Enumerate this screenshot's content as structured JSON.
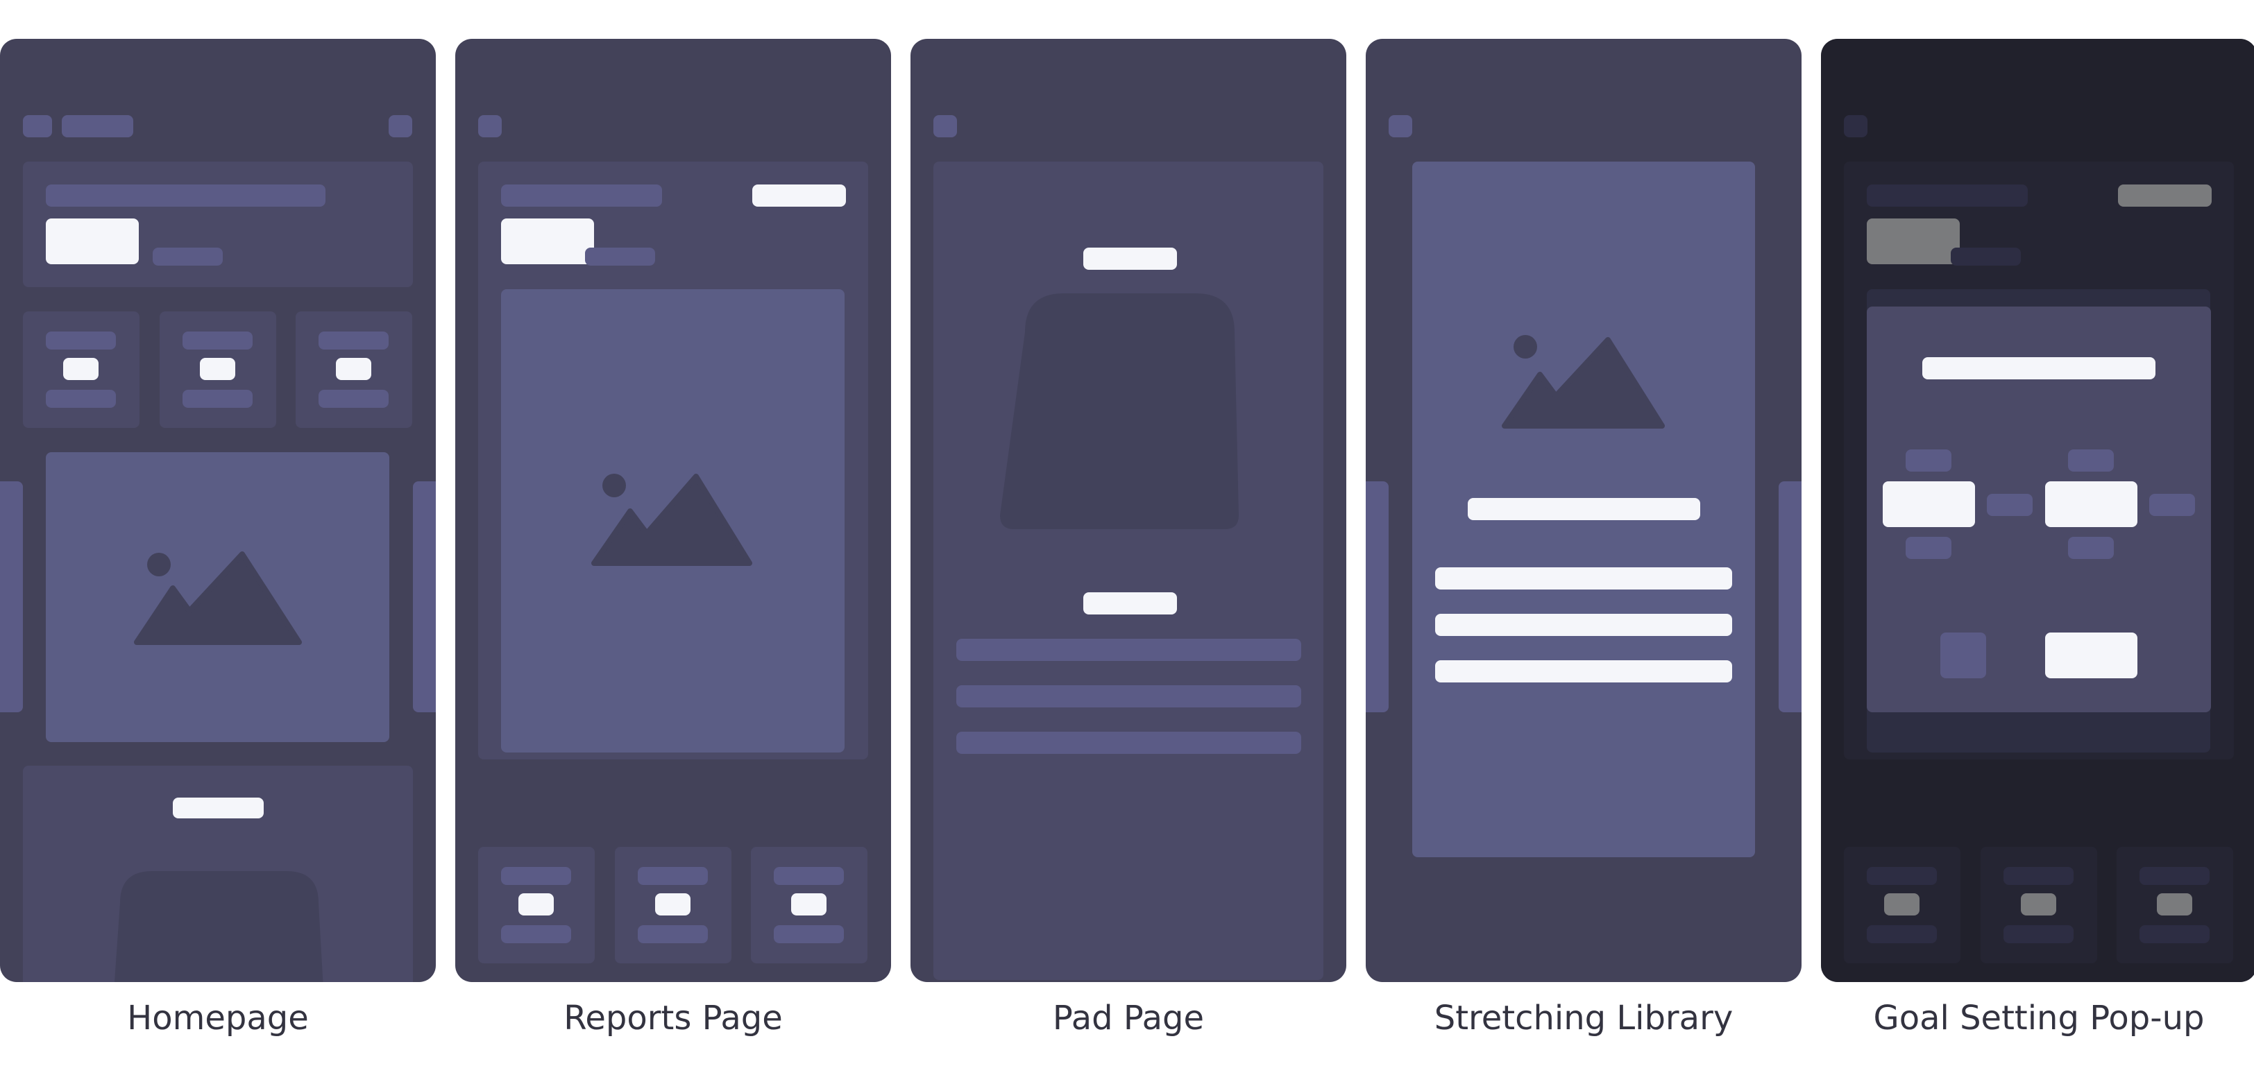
{
  "screens": [
    {
      "caption": "Homepage"
    },
    {
      "caption": "Reports Page"
    },
    {
      "caption": "Pad Page"
    },
    {
      "caption": "Stretching Library"
    },
    {
      "caption": "Goal Setting Pop-up"
    }
  ],
  "colors": {
    "phone_bg": "#434259",
    "card": "#4b4a67",
    "placeholder": "#5b5b86",
    "highlight": "#f5f6fa",
    "image": "#5b5d85",
    "shape": "#42425b",
    "caption_text": "#333340"
  },
  "icons": [
    "image-placeholder-icon"
  ]
}
